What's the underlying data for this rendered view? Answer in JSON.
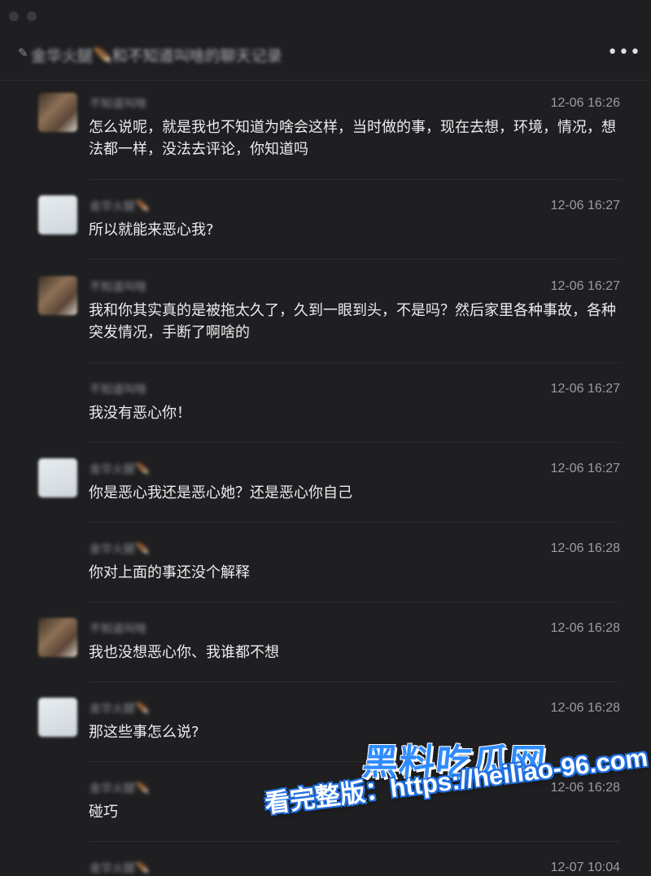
{
  "window": {
    "title": "金华火腿🪶和不知道叫啥的聊天记录",
    "more_icon": "more-horizontal-icon",
    "more_label": "•••"
  },
  "messages": [
    {
      "sender": "不知道叫啥",
      "avatar": "photo",
      "time": "12-06 16:26",
      "text": "怎么说呢，就是我也不知道为啥会这样，当时做的事，现在去想，环境，情况，想法都一样，没法去评论，你知道吗"
    },
    {
      "sender": "金华火腿🪶",
      "avatar": "blank",
      "time": "12-06 16:27",
      "text": "所以就能来恶心我?"
    },
    {
      "sender": "不知道叫啥",
      "avatar": "photo",
      "time": "12-06 16:27",
      "text": "我和你其实真的是被拖太久了，久到一眼到头，不是吗？然后家里各种事故，各种突发情况，手断了啊啥的"
    },
    {
      "sender": "不知道叫啥",
      "avatar": "none",
      "time": "12-06 16:27",
      "text": "我没有恶心你！"
    },
    {
      "sender": "金华火腿🪶",
      "avatar": "blank",
      "time": "12-06 16:27",
      "text": "你是恶心我还是恶心她？还是恶心你自己"
    },
    {
      "sender": "金华火腿🪶",
      "avatar": "none",
      "time": "12-06 16:28",
      "text": "你对上面的事还没个解释"
    },
    {
      "sender": "不知道叫啥",
      "avatar": "photo",
      "time": "12-06 16:28",
      "text": "我也没想恶心你、我谁都不想"
    },
    {
      "sender": "金华火腿🪶",
      "avatar": "blank",
      "time": "12-06 16:28",
      "text": "那这些事怎么说?"
    },
    {
      "sender": "金华火腿🪶",
      "avatar": "none",
      "time": "12-06 16:28",
      "text": "碰巧"
    },
    {
      "sender": "金华火腿🪶",
      "avatar": "none",
      "time": "12-07 10:04",
      "text": ""
    }
  ],
  "watermark": {
    "logo": "黑料吃瓜网",
    "url": "看完整版：https://heiliao-96.com"
  }
}
